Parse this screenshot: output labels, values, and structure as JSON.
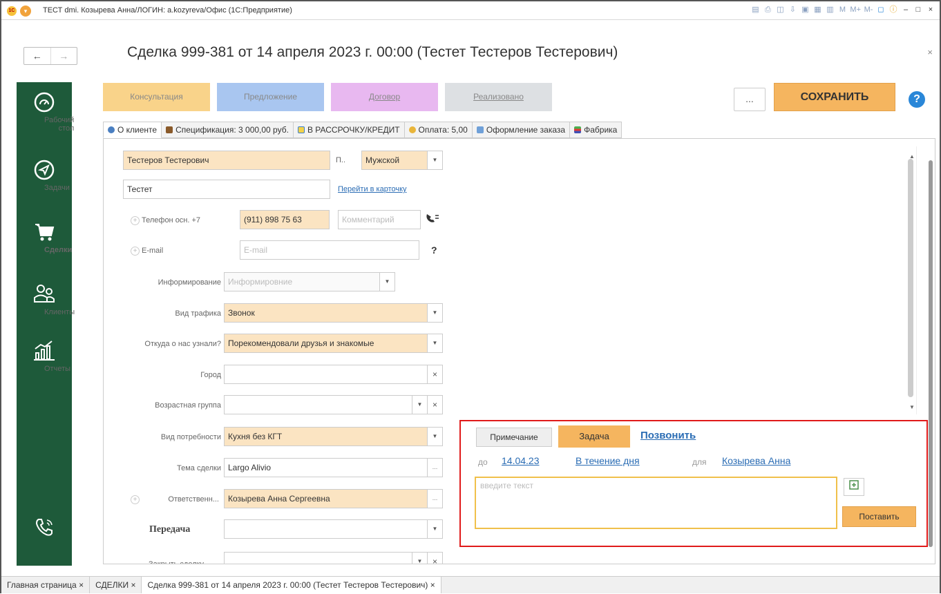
{
  "window": {
    "title": "ТЕСТ dmi. Козырева Анна/ЛОГИН: a.kozyreva/Офис  (1С:Предприятие)",
    "toolbar_icons": [
      "save-icon",
      "print-icon",
      "preview-icon",
      "attach-icon",
      "lock-icon",
      "calc-icon",
      "calendar-icon",
      "m-icon",
      "mplus-icon",
      "mminus-icon",
      "window-icon",
      "info-icon",
      "minimize-icon",
      "maximize-icon",
      "close-icon"
    ],
    "toolbar_labels": {
      "m": "M",
      "mplus": "M+",
      "mminus": "M-"
    }
  },
  "header": {
    "title": "Сделка 999-381 от 14 апреля 2023 г. 00:00 (Тестет Тестеров Тестерович)"
  },
  "sidebar": {
    "items": [
      {
        "label": "Рабочий стол",
        "icon": "dashboard-icon"
      },
      {
        "label": "Задачи",
        "icon": "send-icon"
      },
      {
        "label": "Сделки",
        "icon": "cart-icon"
      },
      {
        "label": "Клиенты",
        "icon": "clients-icon"
      },
      {
        "label": "Отчеты",
        "icon": "chart-icon"
      }
    ],
    "phone_icon": "phone-icon"
  },
  "stages": [
    "Консультация",
    "Предложение",
    "Договор",
    "Реализовано"
  ],
  "actions": {
    "more": "...",
    "save": "СОХРАНИТЬ",
    "help": "?"
  },
  "tabs": [
    "О клиенте",
    "Спецификация: 3 000,00 руб.",
    "В РАССРОЧКУ/КРЕДИТ",
    "Оплата: 5,00",
    "Оформление заказа",
    "Фабрика"
  ],
  "form": {
    "full_name": "Тестеров Тестерович",
    "gender_label": "П..",
    "gender": "Мужской",
    "first_name": "Тестет",
    "goto_card": "Перейти в карточку",
    "phone_label": "Телефон осн.",
    "phone_prefix": "+7",
    "phone": "(911) 898 75 63",
    "phone_comment_placeholder": "Комментарий",
    "email_label": "E-mail",
    "email_placeholder": "E-mail",
    "email_help": "?",
    "inform_label": "Информирование",
    "inform_placeholder": "Информировние",
    "traffic_label": "Вид трафика",
    "traffic": "Звонок",
    "source_label": "Откуда о нас узнали?",
    "source": "Порекомендовали друзья и знакомые",
    "city_label": "Город",
    "city": "",
    "age_label": "Возрастная группа",
    "age": "",
    "need_label": "Вид потребности",
    "need": "Кухня без КГТ",
    "topic_label": "Тема сделки",
    "topic": "Largo Alivio",
    "resp_label": "Ответственн...",
    "resp": "Козырева Анна Сергеевна",
    "transfer_label": "Передача",
    "close_label": "Закрыть сделку"
  },
  "task": {
    "note_btn": "Примечание",
    "task_btn": "Задача",
    "call_link": "Позвонить",
    "until_label": "до",
    "date": "14.04.23",
    "period": "В течение дня",
    "for_label": "для",
    "assignee": "Козырева Анна",
    "input_placeholder": "введите текст",
    "set_btn": "Поставить"
  },
  "bottom_tabs": [
    "Главная страница",
    "СДЕЛКИ",
    "Сделка 999-381 от 14 апреля 2023 г. 00:00 (Тестет Тестеров Тестерович)"
  ],
  "colors": {
    "sidebar": "#1e5a3a",
    "accent": "#f5b55f",
    "link": "#2a6cb4",
    "highlight_box": "#e01a1a"
  }
}
